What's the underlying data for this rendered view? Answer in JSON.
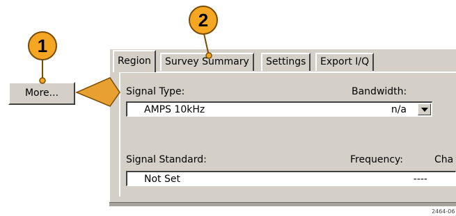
{
  "tabs": [
    {
      "label": "Region",
      "active": true
    },
    {
      "label": "Survey Summary",
      "active": false
    },
    {
      "label": "Settings",
      "active": false
    },
    {
      "label": "Export I/Q",
      "active": false
    }
  ],
  "region": {
    "signal_type_label": "Signal Type:",
    "signal_type_value": "AMPS 10kHz",
    "bandwidth_label": "Bandwidth:",
    "bandwidth_value": "n/a",
    "signal_standard_label": "Signal Standard:",
    "signal_standard_value": "Not Set",
    "frequency_label": "Frequency:",
    "frequency_value": "----",
    "channel_label_partial": "Cha"
  },
  "more_button": {
    "label": "More..."
  },
  "callouts": [
    {
      "number": "1",
      "color": "#f5a623"
    },
    {
      "number": "2",
      "color": "#f5a623"
    }
  ],
  "figure_id": "2464-06",
  "colors": {
    "window_bg": "#d4d0c8",
    "callout": "#f5a623",
    "arrow": "#e8a030"
  }
}
